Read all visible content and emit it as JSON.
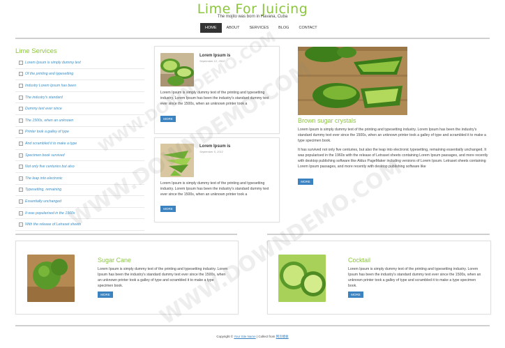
{
  "header": {
    "logo": "Lime For Juicing",
    "tagline": "The mojito was born in Havana, Cuba",
    "nav": [
      "Home",
      "About",
      "Services",
      "Blog",
      "Contact"
    ],
    "nav_active": "Home"
  },
  "sidebar": {
    "title": "Lime Services",
    "items": [
      "Lorem Ipsum is simply dummy text",
      "Of the printing and typesetting",
      "Industry Lorem Ipsum has been",
      "The industry's standard",
      "Dummy text ever since",
      "The 1500s, when an unknown",
      "Printer took a galley of type",
      "And scrambled it to make a type",
      "Specimen book survived",
      "Not only five centuries but also",
      "The leap into electronic",
      "Typesetting, remaining",
      "Essentially unchanged",
      "It was popularised in the 1960s",
      "With the release of Letraset sheets"
    ]
  },
  "posts": [
    {
      "title": "Lorem Ipsum is",
      "date": "September 12, 2012",
      "body": "Lorem Ipsum is simply dummy text of the printing and typesetting industry. Lorem Ipsum has been the industry's standard dummy text ever since the 1500s, when an unknown printer took a",
      "more": "More"
    },
    {
      "title": "Lorem Ipsum is",
      "date": "September 5, 2012",
      "body": "Lorem Ipsum is simply dummy text of the printing and typesetting industry. Lorem Ipsum has been the industry's standard dummy text ever since the 1500s, when an unknown printer took a",
      "more": "More"
    }
  ],
  "feature": {
    "title": "Brown sugar crystals",
    "p1": "Lorem Ipsum is simply dummy text of the printing and typesetting industry. Lorem Ipsum has been the industry's standard dummy text ever since the 1500s, when an unknown printer took a galley of type and scrambled it to make a type specimen book.",
    "p2": "It has survived not only five centuries, but also the leap into electronic typesetting, remaining essentially unchanged. It was popularised in the 1960s with the release of Letraset sheets containing Lorem Ipsum passages, and more recently with desktop publishing software like Aldus PageMaker including versions of Lorem Ipsum. Letraset sheets containing Lorem Ipsum passages, and more recently with desktop publishing software like",
    "more": "More"
  },
  "bottom": [
    {
      "title": "Sugar Cane",
      "body": "Lorem Ipsum is simply dummy text of the printing and typesetting industry. Lorem Ipsum has been the industry's standard dummy text ever since the 1500s, when an unknown printer took a galley of type and scrambled it to make a type specimen book.",
      "more": "More"
    },
    {
      "title": "Cocktail",
      "body": "Lorem Ipsum is simply dummy text of the printing and typesetting industry. Lorem Ipsum has been the industry's standard dummy text ever since the 1500s, when an unknown printer took a galley of type and scrambled it to make a type specimen book.",
      "more": "More"
    }
  ],
  "footer": {
    "prefix": "Copyright ©",
    "site_link": "Your Site Name",
    "middle": "| Collect from",
    "collect_link": "网页模板"
  },
  "watermark": "WWW.DOWNDEMO.COM",
  "colors": {
    "accent_green": "#8cc63f",
    "link_blue": "#3a83c0",
    "nav_active_bg": "#333333"
  }
}
